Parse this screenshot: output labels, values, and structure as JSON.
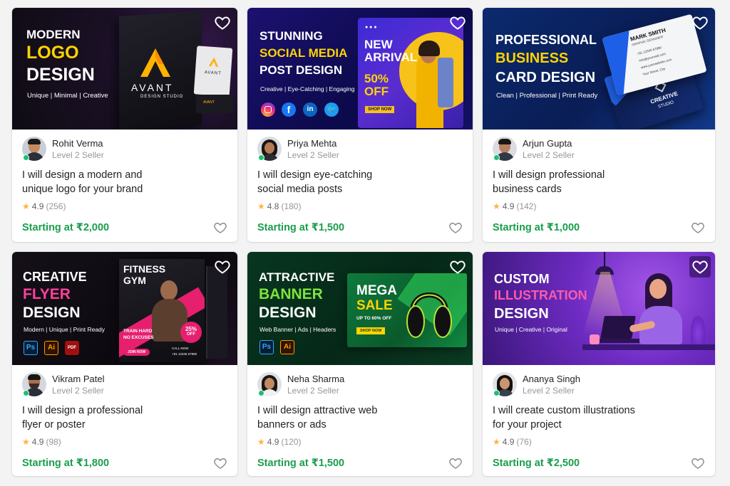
{
  "colors": {
    "accent_green": "#1a9e4c",
    "star": "#ffb33e",
    "online": "#1dbf73"
  },
  "gigs": [
    {
      "banner": {
        "line1": "MODERN",
        "line2": "LOGO",
        "line3": "DESIGN",
        "tags": "Unique | Minimal | Creative",
        "brand": "AVANT",
        "brand_sub": "DESIGN STUDIO",
        "card_brand": "AVANT",
        "card_brand2": "AVANT"
      },
      "seller_name": "Rohit Verma",
      "level": "Level 2 Seller",
      "title_line1": "I will design a modern and",
      "title_line2": "unique logo for your brand",
      "rating": "4.9",
      "reviews": "(256)",
      "price": "Starting at ₹2,000"
    },
    {
      "banner": {
        "line1": "STUNNING",
        "line2": "SOCIAL MEDIA",
        "line3": "POST DESIGN",
        "tags": "Creative | Eye-Catching | Engaging",
        "promo1": "NEW",
        "promo2": "ARRIVAL",
        "promo3": "50%",
        "promo4": "OFF",
        "promo_btn": "SHOP NOW"
      },
      "seller_name": "Priya Mehta",
      "level": "Level 2 Seller",
      "title_line1": "I will design eye-catching",
      "title_line2": "social media posts",
      "rating": "4.8",
      "reviews": "(180)",
      "price": "Starting at ₹1,500"
    },
    {
      "banner": {
        "line1": "PROFESSIONAL",
        "line2": "BUSINESS",
        "line3": "CARD DESIGN",
        "tags": "Clean | Professional | Print Ready",
        "card_name": "MARK SMITH",
        "card_role": "GRAPHIC DESIGNER",
        "card_phone": "+91 12345 67890",
        "card_email": "info@yourmail.com",
        "card_web": "www.yourwebsite.com",
        "card_addr": "Your Street, City",
        "back_brand": "CREATIVE",
        "back_sub": "STUDIO"
      },
      "seller_name": "Arjun Gupta",
      "level": "Level 2 Seller",
      "title_line1": "I will design professional",
      "title_line2": "business cards",
      "rating": "4.9",
      "reviews": "(142)",
      "price": "Starting at ₹1,000"
    },
    {
      "banner": {
        "line1": "CREATIVE",
        "line2": "FLYER",
        "line3": "DESIGN",
        "tags": "Modern | Unique | Print Ready",
        "app1": "Ps",
        "app2": "Ai",
        "app3": "PDF",
        "flyer1": "FITNESS",
        "flyer2": "GYM",
        "flyer3": "TRAIN HARD",
        "flyer4": "NO EXCUSES",
        "flyer_badge1": "25%",
        "flyer_badge2": "OFF",
        "flyer_btn": "JOIN NOW",
        "flyer_phone": "+91 12345 67890",
        "flyer_call": "CALL NOW"
      },
      "seller_name": "Vikram Patel",
      "level": "Level 2 Seller",
      "title_line1": "I will design a professional",
      "title_line2": "flyer or poster",
      "rating": "4.9",
      "reviews": "(98)",
      "price": "Starting at ₹1,800"
    },
    {
      "banner": {
        "line1": "ATTRACTIVE",
        "line2": "BANNER",
        "line3": "DESIGN",
        "tags": "Web Banner | Ads | Headers",
        "app1": "Ps",
        "app2": "Ai",
        "ad1": "MEGA",
        "ad2": "SALE",
        "ad3": "UP TO 60% OFF",
        "ad_btn": "SHOP NOW"
      },
      "seller_name": "Neha Sharma",
      "level": "Level 2 Seller",
      "title_line1": "I will design attractive web",
      "title_line2": "banners or ads",
      "rating": "4.9",
      "reviews": "(120)",
      "price": "Starting at ₹1,500"
    },
    {
      "banner": {
        "line1": "CUSTOM",
        "line2": "ILLUSTRATION",
        "line3": "DESIGN",
        "tags": "Unique | Creative | Original"
      },
      "seller_name": "Ananya Singh",
      "level": "Level 2 Seller",
      "title_line1": "I will create custom illustrations",
      "title_line2": "for your project",
      "rating": "4.9",
      "reviews": "(76)",
      "price": "Starting at ₹2,500"
    }
  ]
}
